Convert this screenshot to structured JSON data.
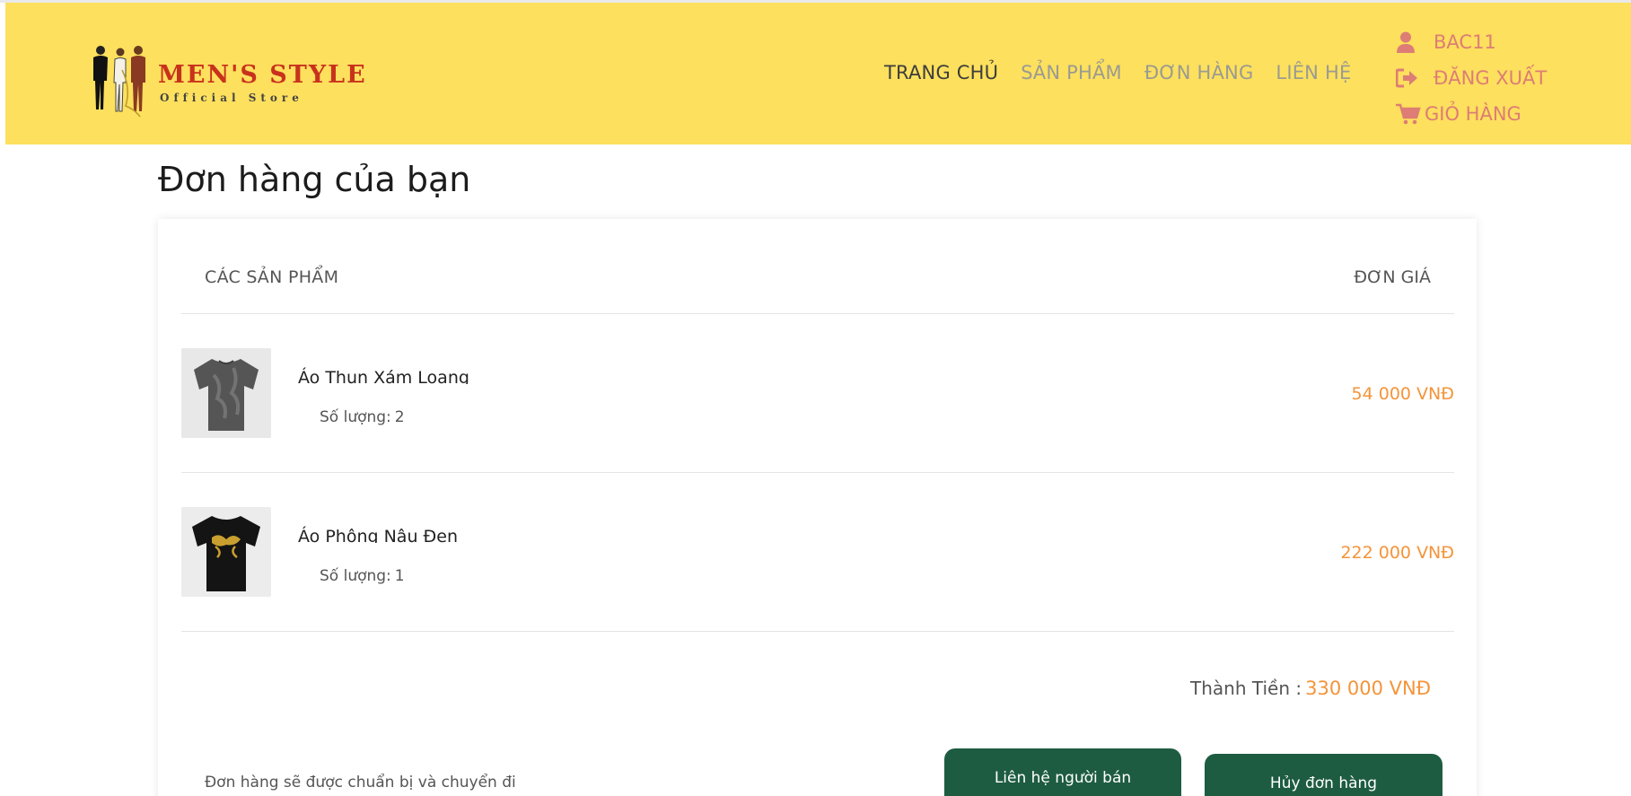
{
  "brand": {
    "name": "MEN'S STYLE",
    "tagline": "Official Store"
  },
  "nav": {
    "items": [
      {
        "label": "TRANG CHỦ",
        "active": true
      },
      {
        "label": "SẢN PHẨM",
        "active": false
      },
      {
        "label": "ĐƠN HÀNG",
        "active": false
      },
      {
        "label": "LIÊN HỆ",
        "active": false
      }
    ]
  },
  "user_menu": {
    "username": "BAC11",
    "logout_label": "ĐĂNG XUẤT",
    "cart_label": "GIỎ HÀNG",
    "icons": [
      "user-icon",
      "sign-out-icon",
      "shopping-cart-icon"
    ]
  },
  "page": {
    "title": "Đơn hàng của bạn"
  },
  "order": {
    "col_products": "CÁC SẢN PHẨM",
    "col_price": "ĐƠN GIÁ",
    "qty_label": "Số lượng:",
    "items": [
      {
        "name": "Áo Thun Xám Loang",
        "qty": "2",
        "price": "54 000 VNĐ",
        "thumb": "grey-tshirt"
      },
      {
        "name": "Áo Phông Nâu Đen",
        "qty": "1",
        "price": "222 000 VNĐ",
        "thumb": "black-tshirt"
      }
    ],
    "total_label": "Thành Tiền :",
    "total_value": "330 000 VNĐ",
    "note": "Đơn hàng sẽ được chuẩn bị và chuyển đi",
    "contact_button": "Liên hệ người bán",
    "cancel_button": "Hủy đơn hàng"
  },
  "colors": {
    "header_bg": "#fde05d",
    "accent_price": "#f4943a",
    "user_menu": "#dd7d75",
    "button_bg": "#1e5c42",
    "brand_red": "#c8321c"
  }
}
